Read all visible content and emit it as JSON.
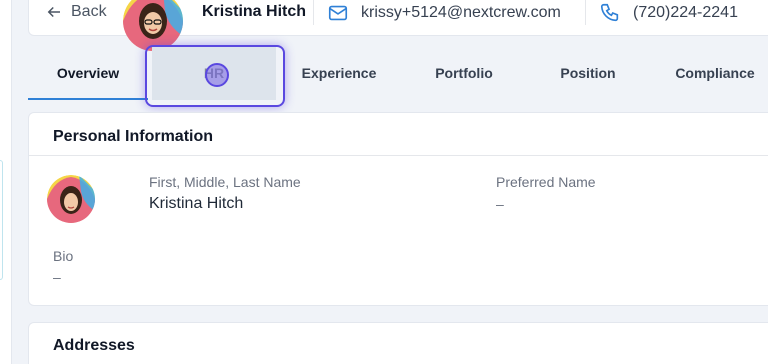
{
  "header": {
    "back_label": "Back",
    "name": "Kristina Hitch",
    "email": "krissy+5124@nextcrew.com",
    "phone": "(720)224-2241"
  },
  "tabs": [
    {
      "label": "Overview",
      "active": true
    },
    {
      "label": "HR",
      "active": false,
      "focused": true
    },
    {
      "label": "Experience",
      "active": false
    },
    {
      "label": "Portfolio",
      "active": false
    },
    {
      "label": "Position",
      "active": false
    },
    {
      "label": "Compliance",
      "active": false
    }
  ],
  "personal_info": {
    "title": "Personal Information",
    "name_label": "First, Middle, Last Name",
    "name_value": "Kristina Hitch",
    "preferred_label": "Preferred Name",
    "preferred_value": "–",
    "bio_label": "Bio",
    "bio_value": "–"
  },
  "addresses": {
    "title": "Addresses"
  },
  "colors": {
    "accent": "#2f80d6",
    "focus": "#5a48e0",
    "icon_blue": "#2f80d6"
  }
}
